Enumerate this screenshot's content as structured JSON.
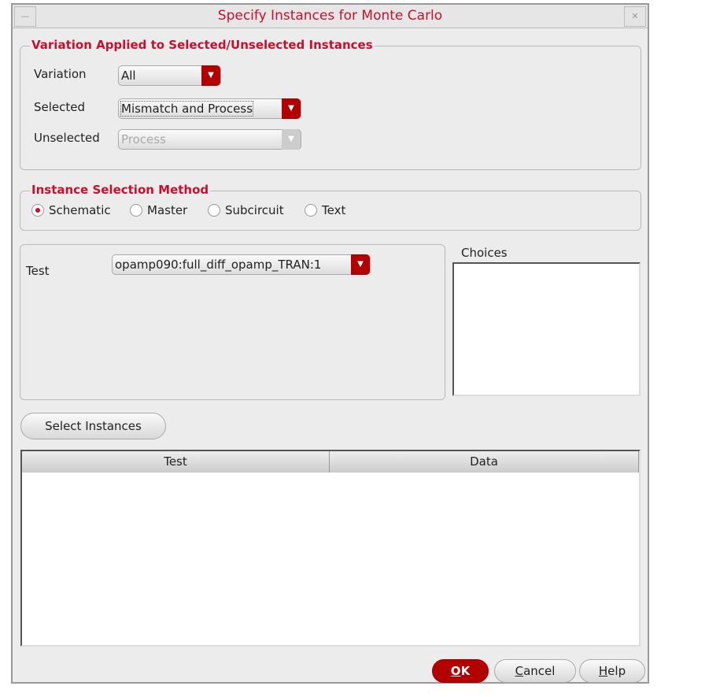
{
  "window": {
    "title": "Specify Instances for Monte Carlo",
    "minimize": "—",
    "close": "✕"
  },
  "variation_group": {
    "title": "Variation Applied to Selected/Unselected Instances",
    "variation_label": "Variation",
    "variation_value": "All",
    "selected_label": "Selected",
    "selected_value": "Mismatch and Process",
    "unselected_label": "Unselected",
    "unselected_value": "Process"
  },
  "method_group": {
    "title": "Instance Selection Method",
    "options": [
      "Schematic",
      "Master",
      "Subcircuit",
      "Text"
    ],
    "selected": "Schematic"
  },
  "test": {
    "label": "Test",
    "value": "opamp090:full_diff_opamp_TRAN:1"
  },
  "choices": {
    "label": "Choices"
  },
  "select_instances": "Select Instances",
  "table": {
    "columns": [
      "Test",
      "Data"
    ],
    "rows": []
  },
  "buttons": {
    "ok_u": "O",
    "ok_rest": "K",
    "cancel_u": "C",
    "cancel_rest": "ancel",
    "help_u": "H",
    "help_rest": "elp"
  }
}
